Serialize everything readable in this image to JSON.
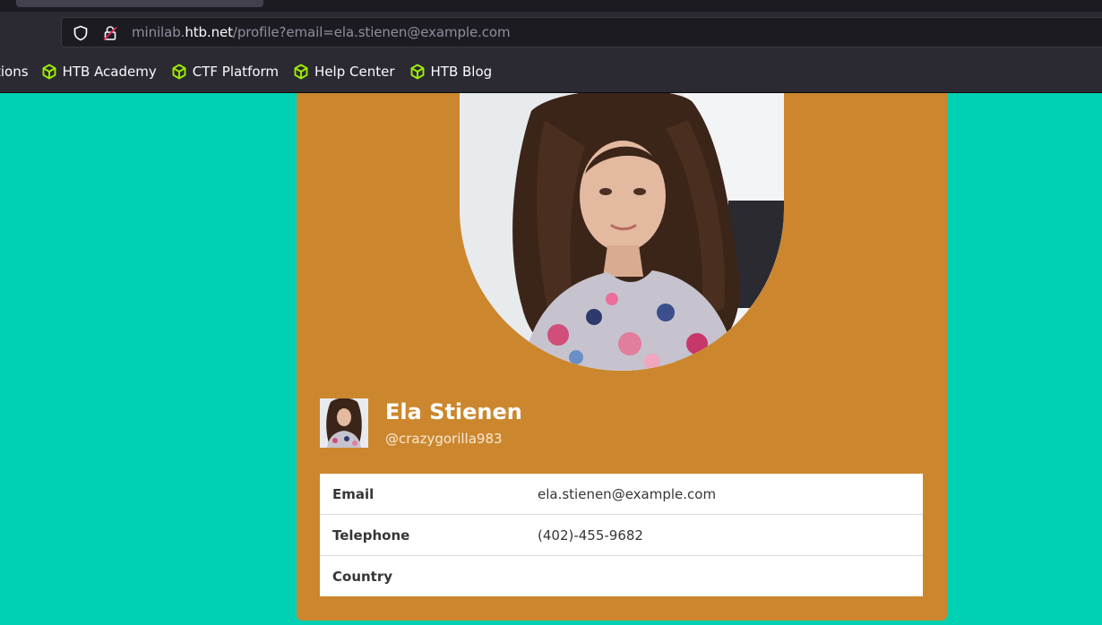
{
  "browser": {
    "url": {
      "prefix": "minilab.",
      "host": "htb.net",
      "path": "/profile?email=ela.stienen@example.com"
    },
    "bookmarks_cut": "tions",
    "bookmarks": [
      {
        "label": "HTB Academy",
        "icon": "hackthebox-cube-icon"
      },
      {
        "label": "CTF Platform",
        "icon": "hackthebox-cube-icon"
      },
      {
        "label": "Help Center",
        "icon": "hackthebox-cube-icon"
      },
      {
        "label": "HTB Blog",
        "icon": "hackthebox-cube-icon"
      }
    ],
    "icons": {
      "shield": "shield-icon",
      "lock": "insecure-lock-icon"
    }
  },
  "colors": {
    "page_bg": "#00d1b2",
    "card_bg": "#cc872e",
    "bookmark_icon": "#9fef00"
  },
  "profile": {
    "name": "Ela Stienen",
    "handle": "@crazygorilla983",
    "fields": [
      {
        "key": "Email",
        "value": "ela.stienen@example.com"
      },
      {
        "key": "Telephone",
        "value": "(402)-455-9682"
      },
      {
        "key": "Country",
        "value": ""
      }
    ]
  }
}
